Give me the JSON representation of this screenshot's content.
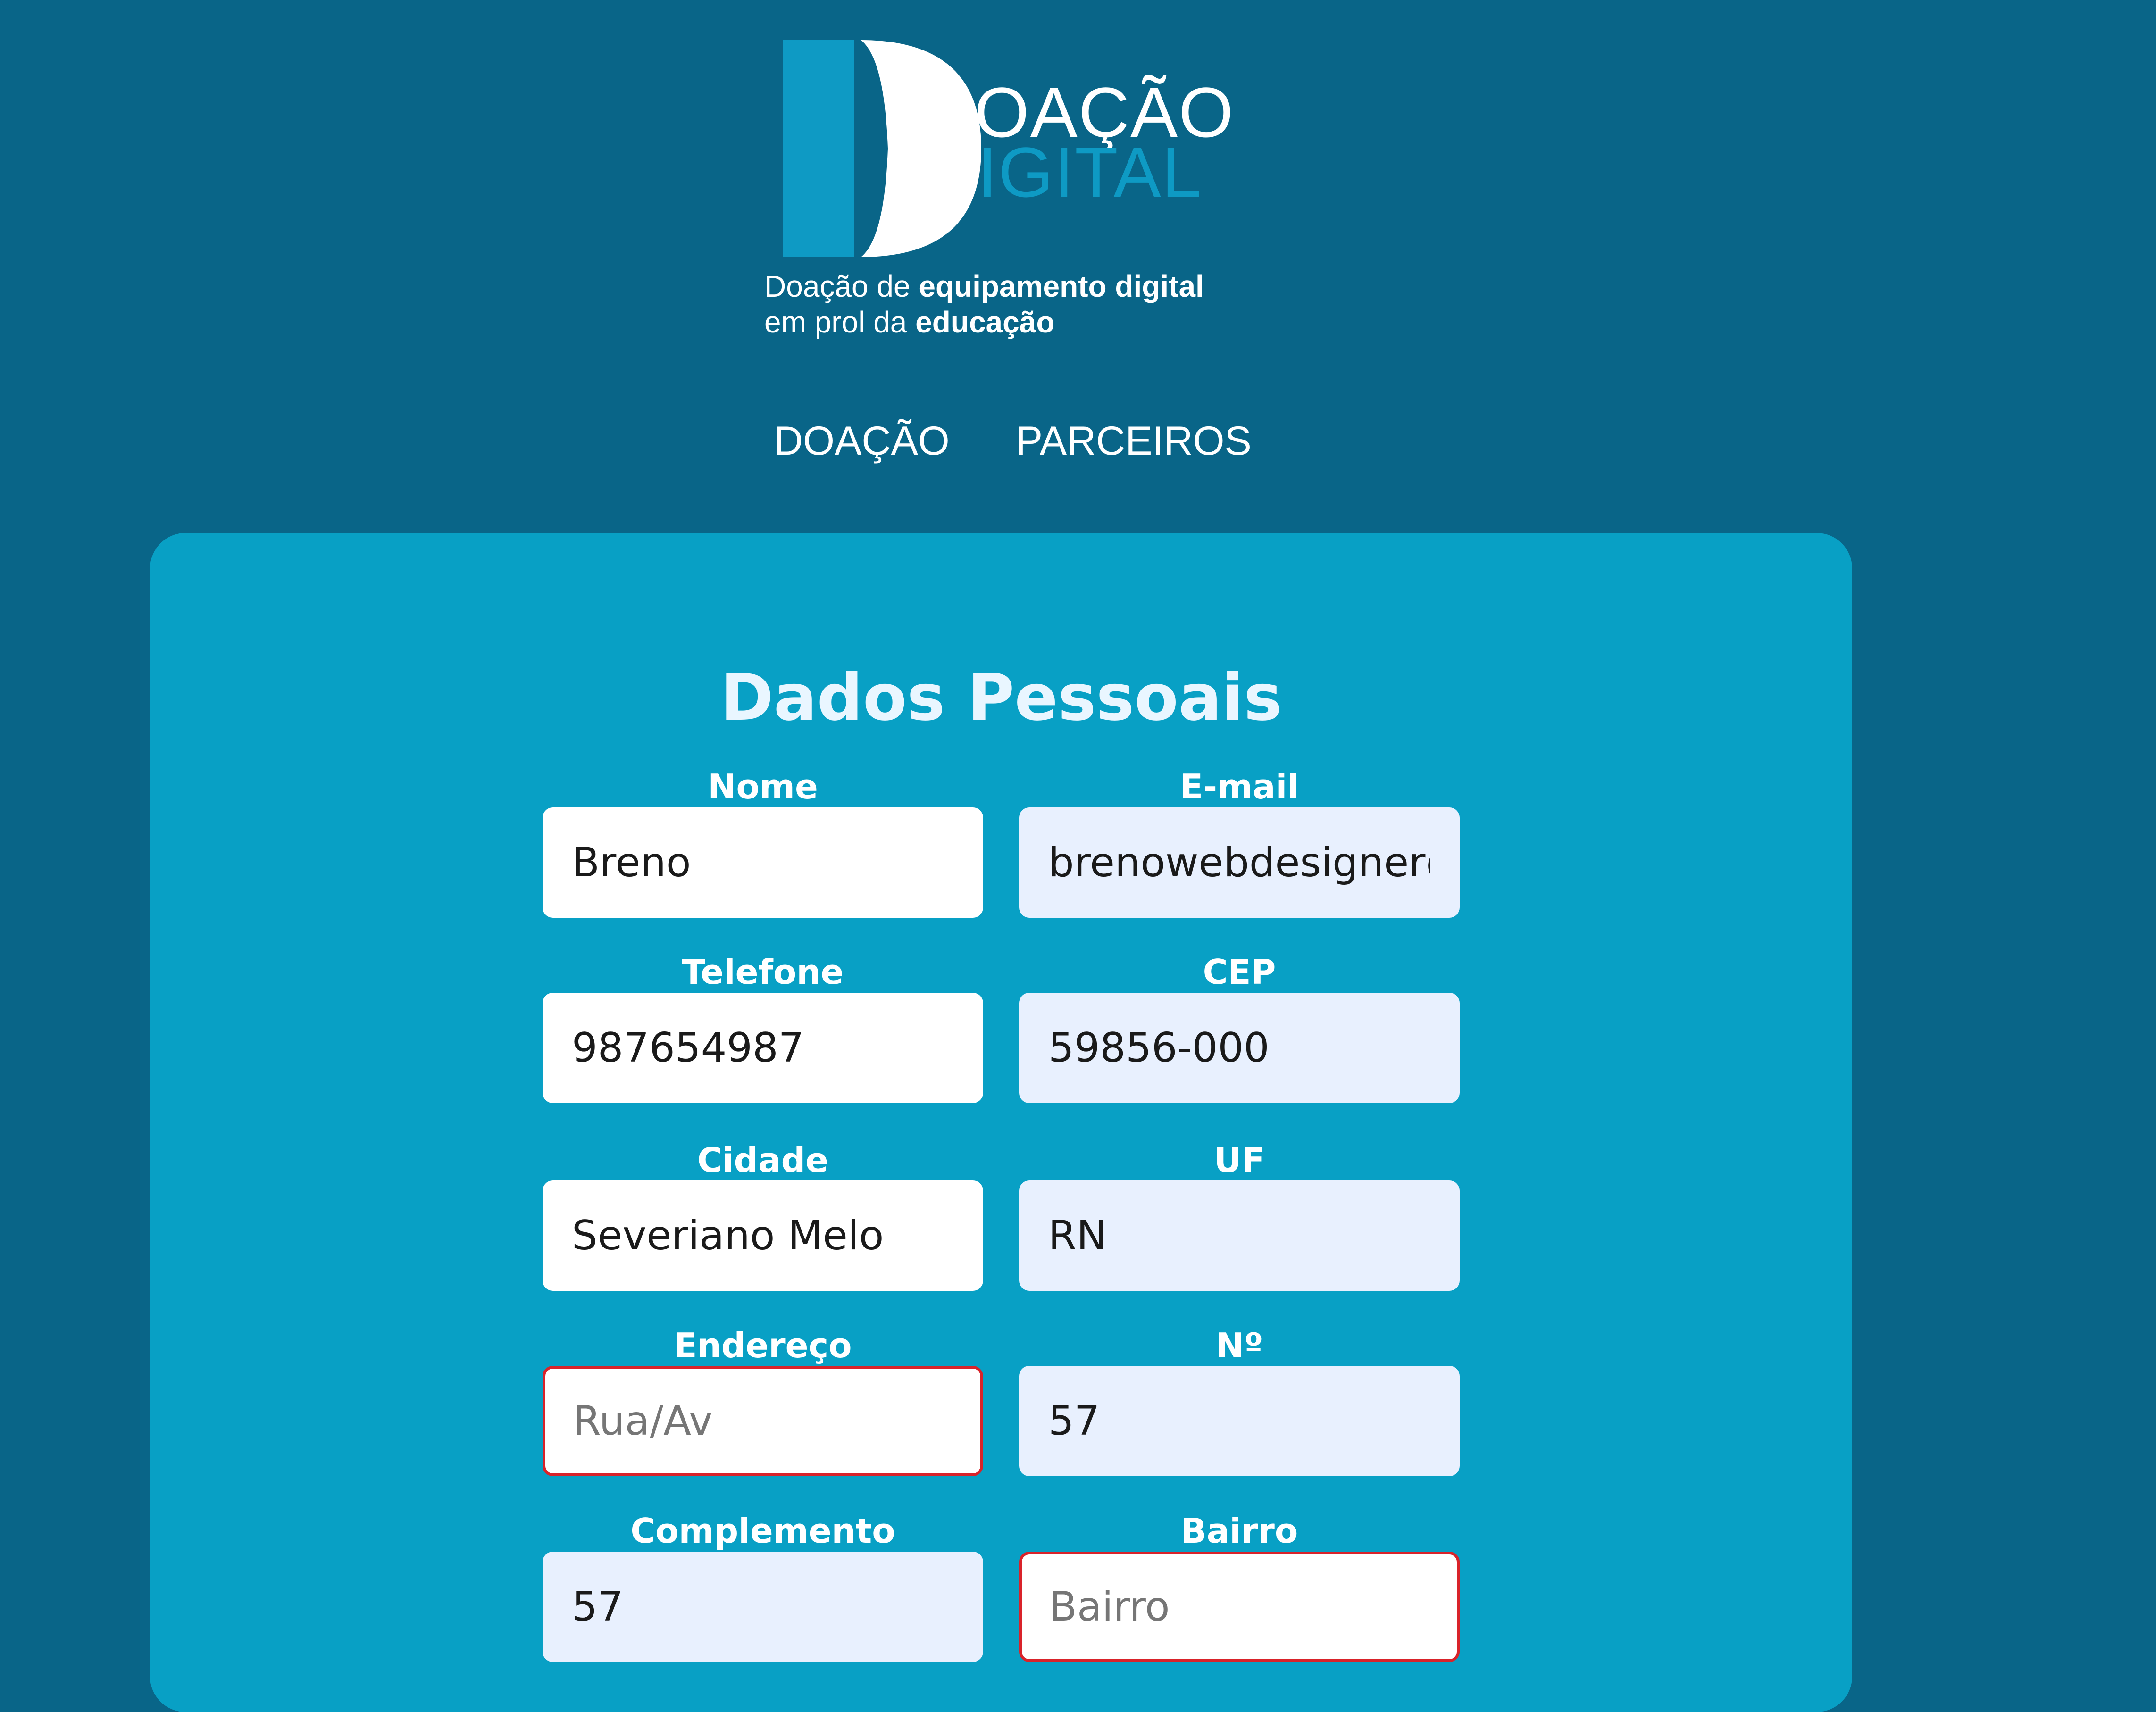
{
  "brand": {
    "word_top": "OAÇÃO",
    "word_bottom": "IGITAL",
    "tagline_line1_a": "Doação de ",
    "tagline_line1_b": "equipamento digital",
    "tagline_line2_a": "em prol da ",
    "tagline_line2_b": "educação",
    "colors": {
      "header_bg": "#096588",
      "logo_accent": "#0e9ac4",
      "card_bg": "#08a0c5",
      "invalid_border": "#d9232a"
    }
  },
  "nav": {
    "items": [
      {
        "label": "DOAÇÃO"
      },
      {
        "label": "PARCEIROS"
      }
    ]
  },
  "form": {
    "title": "Dados Pessoais",
    "fields": {
      "nome": {
        "label": "Nome",
        "value": "Breno",
        "placeholder": ""
      },
      "email": {
        "label": "E-mail",
        "value": "brenowebdesigner@",
        "placeholder": ""
      },
      "telefone": {
        "label": "Telefone",
        "value": "987654987",
        "placeholder": ""
      },
      "cep": {
        "label": "CEP",
        "value": "59856-000",
        "placeholder": ""
      },
      "cidade": {
        "label": "Cidade",
        "value": "Severiano Melo",
        "placeholder": ""
      },
      "uf": {
        "label": "UF",
        "value": "RN",
        "placeholder": ""
      },
      "endereco": {
        "label": "Endereço",
        "value": "",
        "placeholder": "Rua/Av"
      },
      "numero": {
        "label": "Nº",
        "value": "57",
        "placeholder": ""
      },
      "complemento": {
        "label": "Complemento",
        "value": "57",
        "placeholder": ""
      },
      "bairro": {
        "label": "Bairro",
        "value": "",
        "placeholder": "Bairro"
      }
    }
  }
}
